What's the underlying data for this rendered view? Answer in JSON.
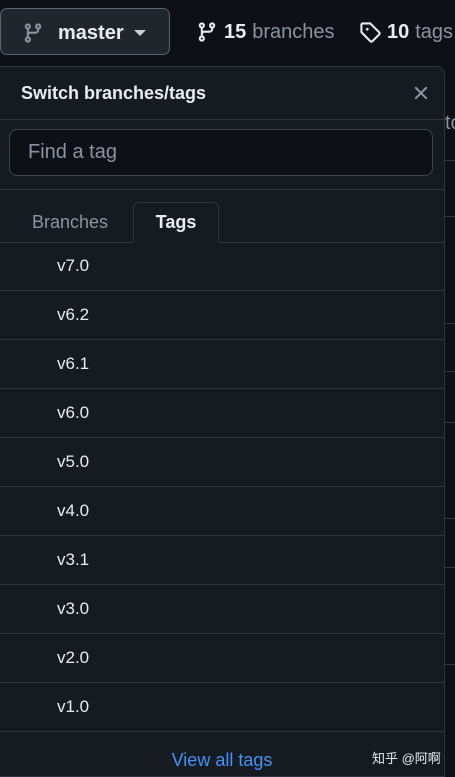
{
  "branch_button": {
    "label": "master"
  },
  "branches_link": {
    "count": "15",
    "label": "branches"
  },
  "tags_link": {
    "count": "10",
    "label": "tags"
  },
  "background": {
    "peek_text": "to"
  },
  "dropdown": {
    "title": "Switch branches/tags",
    "filter": {
      "placeholder": "Find a tag",
      "value": ""
    },
    "tabs": [
      {
        "label": "Branches",
        "selected": false
      },
      {
        "label": "Tags",
        "selected": true
      }
    ],
    "tags": [
      {
        "name": "v7.0"
      },
      {
        "name": "v6.2"
      },
      {
        "name": "v6.1"
      },
      {
        "name": "v6.0"
      },
      {
        "name": "v5.0"
      },
      {
        "name": "v4.0"
      },
      {
        "name": "v3.1"
      },
      {
        "name": "v3.0"
      },
      {
        "name": "v2.0"
      },
      {
        "name": "v1.0"
      }
    ],
    "view_all_label": "View all tags"
  },
  "watermark": "知乎 @阿啊",
  "colors": {
    "background": "#0d1117",
    "panel": "#161b22",
    "border": "#30363d",
    "text": "#e6edf3",
    "muted": "#8b949e",
    "link": "#4493f8"
  },
  "icons": {
    "branch": "git-branch-icon",
    "tag": "tag-icon",
    "close": "close-icon",
    "caret": "caret-down-icon"
  }
}
